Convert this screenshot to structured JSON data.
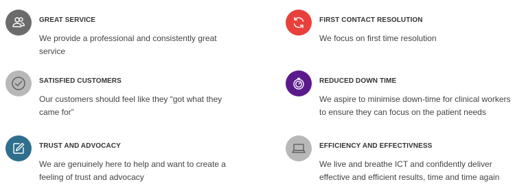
{
  "colors": {
    "grey_dark": "#6b6b6b",
    "grey_light": "#b8b8b8",
    "teal": "#2f6f8d",
    "red": "#e8413c",
    "purple": "#5a1a8c",
    "text": "#444444"
  },
  "features": [
    {
      "icon": "people-icon",
      "title": "GREAT SERVICE",
      "description": "We provide a professional and consistently great service"
    },
    {
      "icon": "check-circle-icon",
      "title": "SATISFIED CUSTOMERS",
      "description": "Our customers should feel like they “got what they came for”"
    },
    {
      "icon": "edit-icon",
      "title": "TRUST AND ADVOCACY",
      "description": "We are genuinely here to help and want to create a feeling of trust and advocacy"
    },
    {
      "icon": "refresh-icon",
      "title": "FIRST CONTACT RESOLUTION",
      "description": "We focus on first time resolution"
    },
    {
      "icon": "timer-icon",
      "title": "REDUCED DOWN TIME",
      "description": "We aspire to minimise down-time for clinical workers to ensure they can focus on the patient needs"
    },
    {
      "icon": "laptop-icon",
      "title": "EFFICIENCY AND EFFECTIVNESS",
      "description": "We live and breathe ICT and confidently deliver effective and efficient results, time and time again"
    }
  ]
}
